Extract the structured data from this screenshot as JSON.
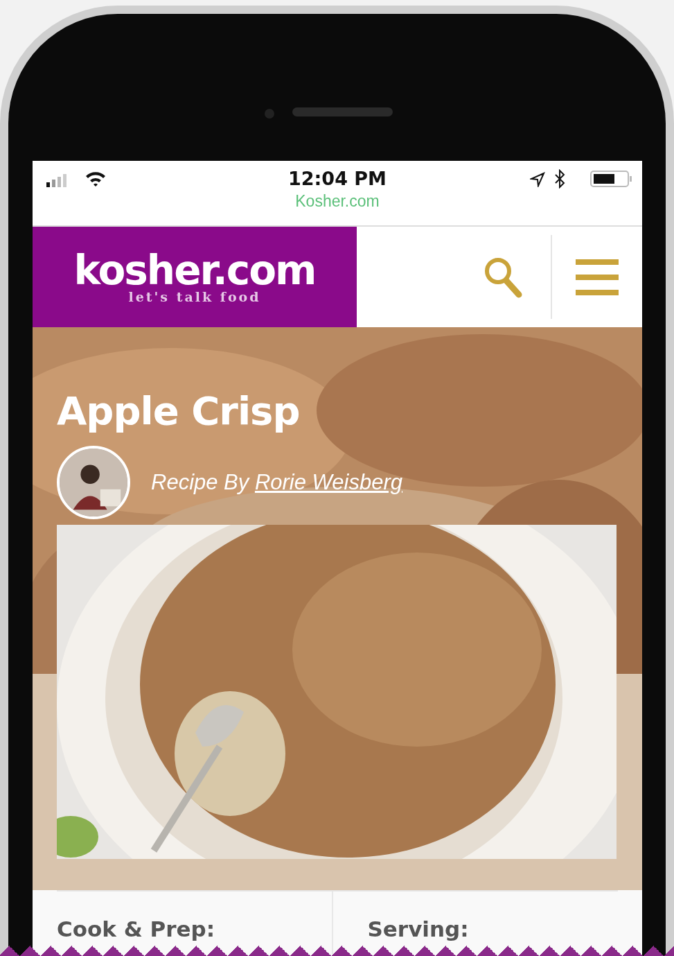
{
  "status_bar": {
    "time": "12:04 PM",
    "url": "Kosher.com"
  },
  "header": {
    "logo": "kosher.com",
    "tagline": "let's talk food"
  },
  "recipe": {
    "title": "Apple Crisp",
    "byline": "Recipe By",
    "author": "Rorie Weisberg"
  },
  "info": [
    {
      "label": "Cook & Prep:"
    },
    {
      "label": "Serving:"
    }
  ]
}
